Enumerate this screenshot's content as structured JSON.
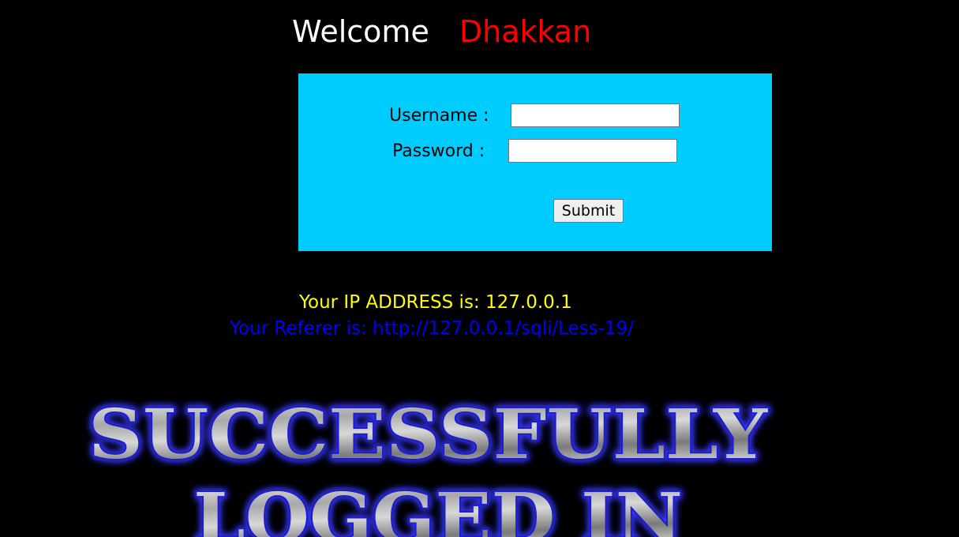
{
  "header": {
    "welcome": "Welcome",
    "name": "Dhakkan"
  },
  "form": {
    "username_label": "Username :",
    "password_label": "Password :",
    "username_value": "",
    "password_value": "",
    "submit_label": "Submit",
    "panel_color": "#00ccff"
  },
  "info": {
    "ip_line": "Your IP ADDRESS is: 127.0.0.1",
    "referer_line": "Your Referer is: http://127.0.0.1/sqli/Less-19/",
    "ip_color": "#ffff00",
    "referer_color": "#0000ff"
  },
  "banner": {
    "line1": "SUCCESSFULLY",
    "line2": "LOGGED IN"
  }
}
